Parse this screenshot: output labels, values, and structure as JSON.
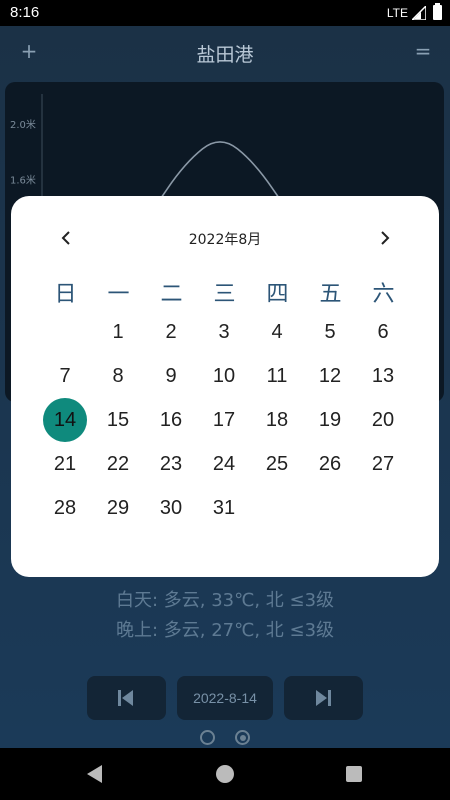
{
  "status_bar": {
    "time": "8:16",
    "network": "LTE"
  },
  "topbar": {
    "title": "盐田港",
    "add_symbol": "+",
    "menu_symbol": "="
  },
  "chart_data": {
    "type": "line",
    "ytick_labels": [
      "2.0米",
      "1.6米"
    ],
    "y_ticks": [
      2.0,
      1.6
    ],
    "series": [
      {
        "x": [
          0,
          1,
          2,
          3,
          4,
          5,
          6
        ],
        "values": [
          1.0,
          1.35,
          1.72,
          1.92,
          1.72,
          1.35,
          1.0
        ]
      }
    ]
  },
  "weather": {
    "day": "白天: 多云, 33℃, 北 ≤3级",
    "night": "晚上: 多云, 27℃, 北 ≤3级"
  },
  "controls": {
    "current_date": "2022-8-14"
  },
  "calendar": {
    "month_label": "2022年8月",
    "weekdays": [
      "日",
      "一",
      "二",
      "三",
      "四",
      "五",
      "六"
    ],
    "selected_day": "14",
    "colors": {
      "selected": "#0f8a7d",
      "weekday_text": "#2c5577"
    },
    "weeks": [
      [
        "",
        "1",
        "2",
        "3",
        "4",
        "5",
        "6"
      ],
      [
        "7",
        "8",
        "9",
        "10",
        "11",
        "12",
        "13"
      ],
      [
        "14",
        "15",
        "16",
        "17",
        "18",
        "19",
        "20"
      ],
      [
        "21",
        "22",
        "23",
        "24",
        "25",
        "26",
        "27"
      ],
      [
        "28",
        "29",
        "30",
        "31",
        "",
        "",
        ""
      ]
    ]
  },
  "nav_icons": [
    "back-icon",
    "home-icon",
    "recents-icon"
  ]
}
